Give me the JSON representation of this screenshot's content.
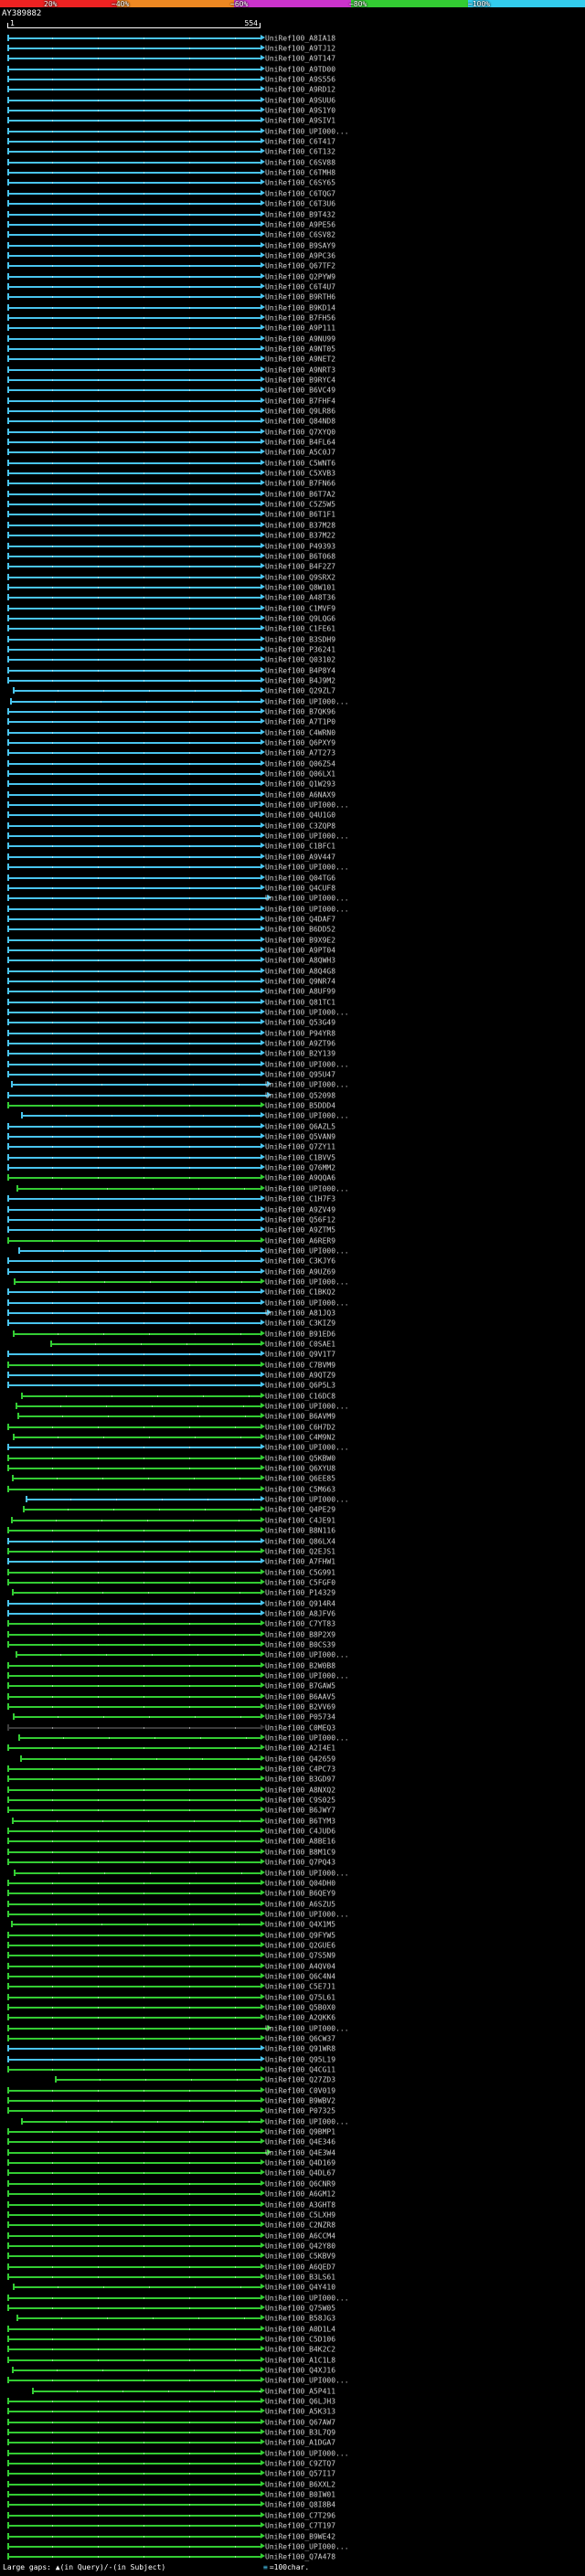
{
  "chart_data": {
    "type": "bar",
    "orientation": "horizontal",
    "description": "BLAST-style graphical overview of alignment hits against the query, one horizontal bar per UniRef100 subject; bar color encodes percent score/identity per the color key; bars span the aligned query range.",
    "title": "AY389882",
    "x_axis": {
      "min": 1,
      "max": 554,
      "start_label": "1",
      "end_label": "554"
    },
    "color_key": {
      "segments": [
        {
          "label": "20%",
          "color": "#ee2222"
        },
        {
          "label": "~40%",
          "color": "#ee8822"
        },
        {
          "label": "~60%",
          "color": "#cc33cc"
        },
        {
          "label": "~80%",
          "color": "#33cc33"
        },
        {
          "label": "~100%",
          "color": "#33ccee"
        }
      ]
    },
    "footer": {
      "gap_legend": "Large gaps: ▲(in Query)/-(in Subject)",
      "scale_symbol": "≡",
      "scale_label": "=100char."
    },
    "row_prefix": "UniRef100_",
    "grade_colors": {
      "c": "#49c4ee",
      "g": "#33cc33",
      "k": "#3c3c3c"
    },
    "row_columns": [
      "id",
      "grade",
      "query_start",
      "query_end",
      "arrow_overhang"
    ],
    "rows": [
      [
        "A8IA18",
        "c",
        1,
        554
      ],
      [
        "A9TJ12",
        "c",
        1,
        554
      ],
      [
        "A9T147",
        "c",
        1,
        554
      ],
      [
        "A9TD00",
        "c",
        1,
        554
      ],
      [
        "A9S556",
        "c",
        1,
        554
      ],
      [
        "A9RD12",
        "c",
        1,
        554
      ],
      [
        "A9SUU6",
        "c",
        1,
        554
      ],
      [
        "A9S1Y0",
        "c",
        1,
        554
      ],
      [
        "A9SIV1",
        "c",
        1,
        554
      ],
      [
        "UPI000...",
        "c",
        1,
        554
      ],
      [
        "C6T417",
        "c",
        1,
        554
      ],
      [
        "C6T132",
        "c",
        1,
        554
      ],
      [
        "C6SV88",
        "c",
        1,
        554
      ],
      [
        "C6TMH8",
        "c",
        1,
        554
      ],
      [
        "C6SY65",
        "c",
        1,
        554
      ],
      [
        "C6TQG7",
        "c",
        1,
        554
      ],
      [
        "C6T3U6",
        "c",
        1,
        554
      ],
      [
        "B9T432",
        "c",
        1,
        554
      ],
      [
        "A9PE56",
        "c",
        1,
        554
      ],
      [
        "C6SV82",
        "c",
        1,
        554
      ],
      [
        "B9SAY9",
        "c",
        1,
        554
      ],
      [
        "A9PC36",
        "c",
        1,
        554
      ],
      [
        "Q67TF2",
        "c",
        1,
        554
      ],
      [
        "Q2PYW9",
        "c",
        1,
        554
      ],
      [
        "C6T4U7",
        "c",
        1,
        554
      ],
      [
        "B9RTH6",
        "c",
        1,
        554
      ],
      [
        "B9KD14",
        "c",
        1,
        554
      ],
      [
        "B7FH56",
        "c",
        1,
        554
      ],
      [
        "A9P111",
        "c",
        1,
        554
      ],
      [
        "A9NU99",
        "c",
        1,
        554
      ],
      [
        "A9NT05",
        "c",
        1,
        554
      ],
      [
        "A9NET2",
        "c",
        1,
        554
      ],
      [
        "A9NRT3",
        "c",
        1,
        554
      ],
      [
        "B9RYC4",
        "c",
        1,
        554
      ],
      [
        "B6VC49",
        "c",
        1,
        554
      ],
      [
        "B7FHF4",
        "c",
        1,
        554
      ],
      [
        "Q9LR86",
        "c",
        1,
        554
      ],
      [
        "Q84ND8",
        "c",
        1,
        554
      ],
      [
        "Q7XYQ0",
        "c",
        1,
        554
      ],
      [
        "B4FL64",
        "c",
        1,
        554
      ],
      [
        "A5C0J7",
        "c",
        1,
        554
      ],
      [
        "C5WNT6",
        "c",
        1,
        554
      ],
      [
        "C5XVB3",
        "c",
        1,
        554
      ],
      [
        "B7FN66",
        "c",
        1,
        554
      ],
      [
        "B6T7A2",
        "c",
        1,
        554
      ],
      [
        "C5Z5W5",
        "c",
        1,
        554
      ],
      [
        "B6T1F1",
        "c",
        1,
        554
      ],
      [
        "B37M28",
        "c",
        1,
        554
      ],
      [
        "B37M22",
        "c",
        1,
        554
      ],
      [
        "P49393",
        "c",
        1,
        554
      ],
      [
        "B6T068",
        "c",
        1,
        554
      ],
      [
        "B4F2Z7",
        "c",
        1,
        554
      ],
      [
        "Q9SRX2",
        "c",
        1,
        554
      ],
      [
        "Q8W101",
        "c",
        1,
        554
      ],
      [
        "A48T36",
        "c",
        1,
        554
      ],
      [
        "C1MVF9",
        "c",
        1,
        554
      ],
      [
        "Q9LQG6",
        "c",
        1,
        554
      ],
      [
        "C1FE61",
        "c",
        1,
        554
      ],
      [
        "B3SDH9",
        "c",
        1,
        554
      ],
      [
        "P36241",
        "c",
        1,
        554
      ],
      [
        "Q03102",
        "c",
        1,
        554
      ],
      [
        "B4P8Y4",
        "c",
        1,
        554
      ],
      [
        "B4J9M2",
        "c",
        1,
        554
      ],
      [
        "Q29ZL7",
        "c",
        12,
        554
      ],
      [
        "UPI000...",
        "c",
        6,
        554
      ],
      [
        "B7QK96",
        "c",
        1,
        554
      ],
      [
        "A7T1P0",
        "c",
        1,
        554
      ],
      [
        "C4WRN0",
        "c",
        1,
        554
      ],
      [
        "Q6PXY9",
        "c",
        1,
        554
      ],
      [
        "A7T273",
        "c",
        1,
        554
      ],
      [
        "Q06Z54",
        "c",
        1,
        554
      ],
      [
        "Q06LX1",
        "c",
        1,
        554
      ],
      [
        "Q1W293",
        "c",
        1,
        554
      ],
      [
        "A6NAX9",
        "c",
        1,
        554
      ],
      [
        "UPI000...",
        "c",
        1,
        554
      ],
      [
        "Q4U1G0",
        "c",
        1,
        554
      ],
      [
        "C3ZQP8",
        "c",
        1,
        554
      ],
      [
        "UPI000...",
        "c",
        1,
        554
      ],
      [
        "C1BFC1",
        "c",
        1,
        554
      ],
      [
        "A9V447",
        "c",
        1,
        554
      ],
      [
        "UPI000...",
        "c",
        1,
        554
      ],
      [
        "Q04TG6",
        "c",
        1,
        554
      ],
      [
        "Q4CUF8",
        "c",
        1,
        554
      ],
      [
        "UPI000...",
        "c",
        1,
        554,
        1
      ],
      [
        "UPI000...",
        "c",
        1,
        554
      ],
      [
        "Q4DAF7",
        "c",
        1,
        554
      ],
      [
        "B6DD52",
        "c",
        1,
        554
      ],
      [
        "B9X9E2",
        "c",
        1,
        554
      ],
      [
        "A9PT04",
        "c",
        1,
        554
      ],
      [
        "A8QWH3",
        "c",
        1,
        554
      ],
      [
        "A8Q4G8",
        "c",
        1,
        554
      ],
      [
        "Q9NR74",
        "c",
        1,
        554
      ],
      [
        "A8UF99",
        "c",
        1,
        554
      ],
      [
        "Q81TC1",
        "c",
        1,
        554
      ],
      [
        "UPI000...",
        "c",
        1,
        554
      ],
      [
        "Q53G49",
        "c",
        1,
        554
      ],
      [
        "P94YR8",
        "c",
        1,
        554
      ],
      [
        "A9ZT96",
        "c",
        1,
        554
      ],
      [
        "B2Y139",
        "c",
        1,
        554
      ],
      [
        "UPI000...",
        "c",
        1,
        554
      ],
      [
        "Q95U47",
        "c",
        1,
        554
      ],
      [
        "UPI000...",
        "c",
        8,
        554,
        1
      ],
      [
        "Q52098",
        "c",
        1,
        554,
        1
      ],
      [
        "B5DDD4",
        "g",
        1,
        554
      ],
      [
        "UPI000...",
        "c",
        30,
        554
      ],
      [
        "Q6AZL5",
        "c",
        1,
        554
      ],
      [
        "Q5VAN9",
        "c",
        1,
        554
      ],
      [
        "Q7ZY11",
        "c",
        1,
        554
      ],
      [
        "C1BVV5",
        "c",
        1,
        554
      ],
      [
        "Q76MM2",
        "c",
        1,
        554
      ],
      [
        "A9QQA6",
        "g",
        1,
        554
      ],
      [
        "UPI000...",
        "g",
        20,
        554
      ],
      [
        "C1H7F3",
        "c",
        1,
        554
      ],
      [
        "A9ZV49",
        "c",
        1,
        554
      ],
      [
        "Q56F12",
        "c",
        1,
        554
      ],
      [
        "A9ZTM5",
        "c",
        1,
        554
      ],
      [
        "A6RER9",
        "g",
        1,
        554
      ],
      [
        "UPI000...",
        "c",
        25,
        554
      ],
      [
        "C3KJY6",
        "c",
        1,
        554
      ],
      [
        "A9UZ69",
        "c",
        1,
        554
      ],
      [
        "UPI000...",
        "g",
        15,
        554
      ],
      [
        "C1BKQ2",
        "c",
        1,
        554
      ],
      [
        "UPI000...",
        "c",
        1,
        554
      ],
      [
        "A81JQ3",
        "c",
        1,
        554,
        1
      ],
      [
        "C3KIZ9",
        "c",
        1,
        554
      ],
      [
        "B91ED6",
        "g",
        12,
        554
      ],
      [
        "C0SAE1",
        "g",
        95,
        554
      ],
      [
        "Q9V1T7",
        "c",
        1,
        554
      ],
      [
        "C7BVM9",
        "g",
        1,
        554
      ],
      [
        "A9QTZ9",
        "c",
        1,
        554
      ],
      [
        "Q6P5L3",
        "c",
        1,
        554
      ],
      [
        "C16DC8",
        "g",
        30,
        554
      ],
      [
        "UPI000...",
        "g",
        18,
        554
      ],
      [
        "B6AVM9",
        "g",
        22,
        554
      ],
      [
        "C6H7D2",
        "g",
        1,
        554
      ],
      [
        "C4M9N2",
        "g",
        12,
        554
      ],
      [
        "UPI000...",
        "c",
        1,
        554
      ],
      [
        "Q5KBW0",
        "g",
        1,
        554
      ],
      [
        "Q6XYU8",
        "g",
        1,
        554
      ],
      [
        "Q6EE85",
        "g",
        10,
        554
      ],
      [
        "C5M663",
        "g",
        1,
        554
      ],
      [
        "UPI000...",
        "c",
        40,
        554
      ],
      [
        "Q4PE29",
        "g",
        35,
        554
      ],
      [
        "C4JE91",
        "g",
        8,
        554
      ],
      [
        "B8N116",
        "g",
        1,
        554
      ],
      [
        "Q86LX4",
        "c",
        1,
        554
      ],
      [
        "Q2EJS1",
        "g",
        1,
        554
      ],
      [
        "A7FHW1",
        "c",
        1,
        554
      ],
      [
        "C5G991",
        "g",
        1,
        554
      ],
      [
        "C5FGF0",
        "g",
        1,
        554
      ],
      [
        "P14329",
        "g",
        10,
        554
      ],
      [
        "Q914R4",
        "c",
        1,
        554
      ],
      [
        "A8JFV6",
        "c",
        1,
        554
      ],
      [
        "C7YT83",
        "g",
        1,
        554
      ],
      [
        "B8P2X9",
        "g",
        1,
        554
      ],
      [
        "B0CS39",
        "g",
        1,
        554
      ],
      [
        "UPI000...",
        "g",
        18,
        554
      ],
      [
        "B2W0B8",
        "g",
        1,
        554
      ],
      [
        "UPI000...",
        "g",
        1,
        554
      ],
      [
        "B7GAW5",
        "g",
        1,
        554
      ],
      [
        "B6AAV5",
        "g",
        1,
        554
      ],
      [
        "B2VV69",
        "g",
        1,
        554
      ],
      [
        "P05734",
        "g",
        12,
        554
      ],
      [
        "C0MEQ3",
        "k",
        1,
        554
      ],
      [
        "UPI000...",
        "g",
        25,
        554
      ],
      [
        "A2I4E1",
        "g",
        1,
        554
      ],
      [
        "Q42659",
        "g",
        28,
        554
      ],
      [
        "C4PC73",
        "g",
        1,
        554
      ],
      [
        "B3GD97",
        "g",
        1,
        554
      ],
      [
        "A8NXQ2",
        "g",
        1,
        554
      ],
      [
        "C9S025",
        "g",
        1,
        554
      ],
      [
        "B6JWY7",
        "g",
        1,
        554
      ],
      [
        "B6TYM3",
        "g",
        10,
        554
      ],
      [
        "C4JUD6",
        "g",
        1,
        554
      ],
      [
        "A8BE16",
        "g",
        1,
        554
      ],
      [
        "B8M1C9",
        "g",
        1,
        554
      ],
      [
        "Q7PQ43",
        "g",
        1,
        554
      ],
      [
        "UPI000...",
        "g",
        15,
        554
      ],
      [
        "Q04DH0",
        "g",
        1,
        554
      ],
      [
        "B6QEY9",
        "g",
        1,
        554
      ],
      [
        "A6SZU5",
        "g",
        1,
        554
      ],
      [
        "UPI000...",
        "g",
        1,
        554
      ],
      [
        "Q4X1M5",
        "g",
        8,
        554
      ],
      [
        "Q9FYW5",
        "g",
        1,
        554
      ],
      [
        "Q2GUE6",
        "g",
        1,
        554
      ],
      [
        "Q7S5N9",
        "g",
        1,
        554
      ],
      [
        "A4QV04",
        "g",
        1,
        554
      ],
      [
        "Q6C4N4",
        "g",
        1,
        554
      ],
      [
        "C5E7J1",
        "g",
        1,
        554
      ],
      [
        "Q75L61",
        "g",
        1,
        554
      ],
      [
        "Q5B0X0",
        "g",
        1,
        554
      ],
      [
        "A2QKK6",
        "g",
        1,
        554
      ],
      [
        "UPI000...",
        "g",
        1,
        554,
        1
      ],
      [
        "Q6CW37",
        "g",
        1,
        554
      ],
      [
        "Q91WR8",
        "c",
        1,
        554
      ],
      [
        "Q95L19",
        "c",
        1,
        554
      ],
      [
        "Q4CG11",
        "g",
        1,
        554
      ],
      [
        "Q27ZD3",
        "g",
        105,
        554
      ],
      [
        "C0V019",
        "g",
        1,
        554
      ],
      [
        "B9WBV2",
        "g",
        1,
        554
      ],
      [
        "P07325",
        "g",
        1,
        554
      ],
      [
        "UPI000...",
        "g",
        30,
        554
      ],
      [
        "Q9BMP1",
        "g",
        1,
        554
      ],
      [
        "Q4E346",
        "g",
        1,
        554
      ],
      [
        "Q4E3W4",
        "g",
        1,
        554,
        1
      ],
      [
        "Q4D169",
        "g",
        1,
        554
      ],
      [
        "Q4DL67",
        "g",
        1,
        554
      ],
      [
        "Q6CNR9",
        "g",
        1,
        554
      ],
      [
        "A6GM12",
        "g",
        1,
        554
      ],
      [
        "A3GHT8",
        "g",
        1,
        554
      ],
      [
        "C5LXH9",
        "g",
        1,
        554
      ],
      [
        "C2NZR8",
        "g",
        1,
        554
      ],
      [
        "A6CCM4",
        "g",
        1,
        554
      ],
      [
        "Q42Y80",
        "g",
        1,
        554
      ],
      [
        "C5KBV9",
        "g",
        1,
        554
      ],
      [
        "A6QED7",
        "g",
        1,
        554
      ],
      [
        "B3LS61",
        "g",
        1,
        554
      ],
      [
        "Q4Y410",
        "g",
        12,
        554
      ],
      [
        "UPI000...",
        "g",
        1,
        554
      ],
      [
        "Q75W05",
        "g",
        1,
        554
      ],
      [
        "B58JG3",
        "g",
        20,
        554
      ],
      [
        "A0D1L4",
        "g",
        1,
        554
      ],
      [
        "C5D106",
        "g",
        1,
        554
      ],
      [
        "B4K2C2",
        "g",
        1,
        554
      ],
      [
        "A1C1L8",
        "g",
        1,
        554
      ],
      [
        "Q4XJ16",
        "g",
        10,
        554
      ],
      [
        "UPI000...",
        "g",
        1,
        554
      ],
      [
        "A5P411",
        "g",
        55,
        554
      ],
      [
        "Q6LJH3",
        "g",
        1,
        554
      ],
      [
        "A5K313",
        "g",
        1,
        554
      ],
      [
        "Q67AW7",
        "g",
        1,
        554
      ],
      [
        "B3L7Q9",
        "g",
        1,
        554
      ],
      [
        "A1DGA7",
        "g",
        1,
        554
      ],
      [
        "UPI000...",
        "g",
        1,
        554
      ],
      [
        "C9ZTQ7",
        "g",
        1,
        554
      ],
      [
        "Q57I17",
        "g",
        1,
        554
      ],
      [
        "B6XXL2",
        "g",
        1,
        554
      ],
      [
        "B0IW01",
        "g",
        1,
        554
      ],
      [
        "Q8I8B4",
        "g",
        1,
        554
      ],
      [
        "C7T296",
        "g",
        1,
        554
      ],
      [
        "C7T197",
        "g",
        1,
        554
      ],
      [
        "B9WE42",
        "g",
        1,
        554
      ],
      [
        "UPI000...",
        "g",
        1,
        554
      ],
      [
        "Q7A478",
        "g",
        1,
        554
      ]
    ]
  }
}
